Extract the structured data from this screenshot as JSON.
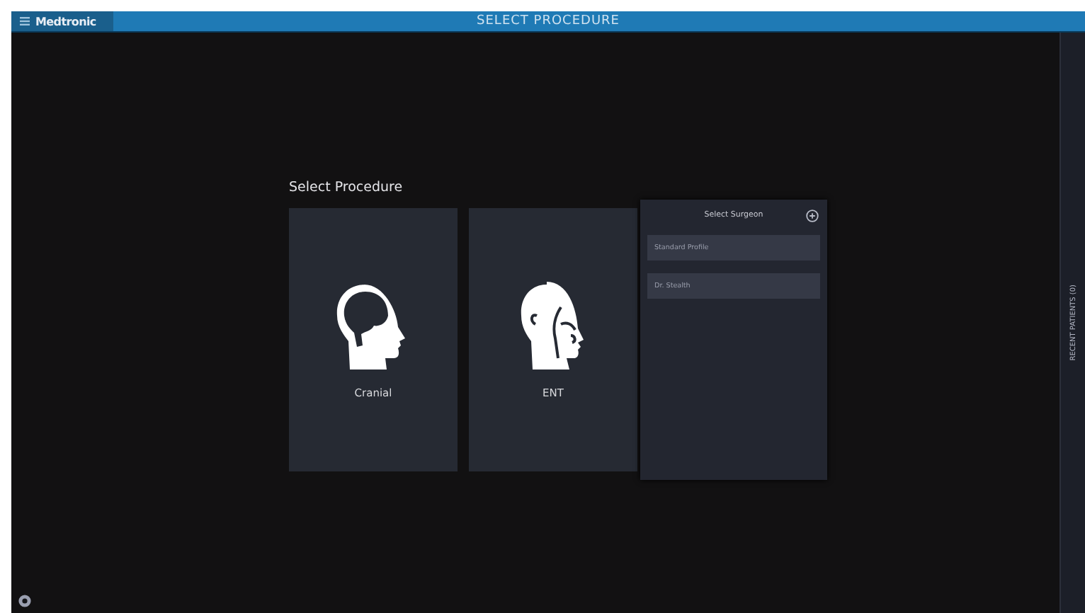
{
  "header": {
    "brand": "Medtronic",
    "title": "SELECT PROCEDURE"
  },
  "heading": "Select Procedure",
  "procedures": [
    {
      "label": "Cranial",
      "kind": "cranial"
    },
    {
      "label": "ENT",
      "kind": "ent"
    }
  ],
  "surgeon_panel": {
    "title": "Select Surgeon",
    "profiles": [
      "Standard Profile",
      "Dr. Stealth"
    ]
  },
  "side_tab": "RECENT PATIENTS (0)"
}
